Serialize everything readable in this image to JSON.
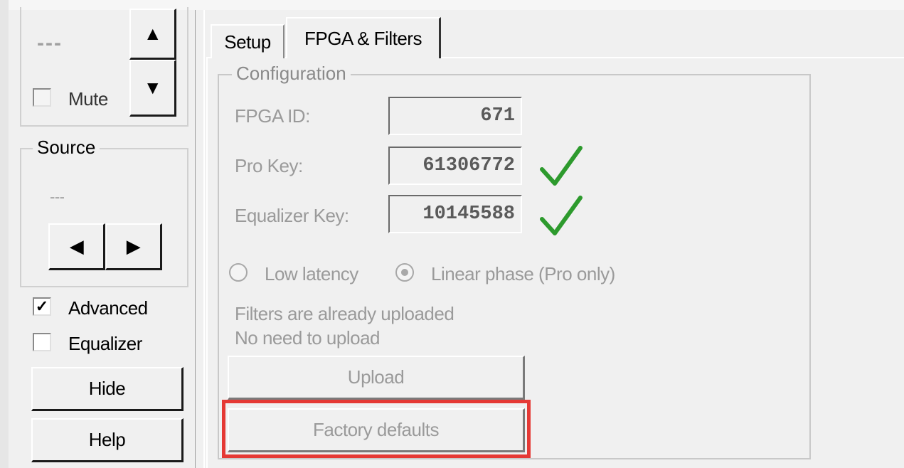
{
  "left_panel": {
    "level_display": "---",
    "mute_label": "Mute",
    "source": {
      "legend": "Source",
      "value": "---"
    },
    "advanced_label": "Advanced",
    "equalizer_label": "Equalizer",
    "hide_label": "Hide",
    "help_label": "Help"
  },
  "tabs": [
    {
      "label": "Setup"
    },
    {
      "label": "FPGA & Filters",
      "active": true
    }
  ],
  "configuration": {
    "legend": "Configuration",
    "fpga_id_label": "FPGA ID:",
    "fpga_id_value": "671",
    "pro_key_label": "Pro Key:",
    "pro_key_value": "61306772",
    "equalizer_key_label": "Equalizer Key:",
    "equalizer_key_value": "10145588",
    "low_latency_label": "Low latency",
    "linear_phase_label": "Linear phase (Pro only)",
    "status_line1": "Filters are already uploaded",
    "status_line2": "No need to upload",
    "upload_label": "Upload",
    "factory_defaults_label": "Factory defaults"
  },
  "colors": {
    "highlight": "#e53935",
    "checkmark": "#2d9a2d"
  }
}
